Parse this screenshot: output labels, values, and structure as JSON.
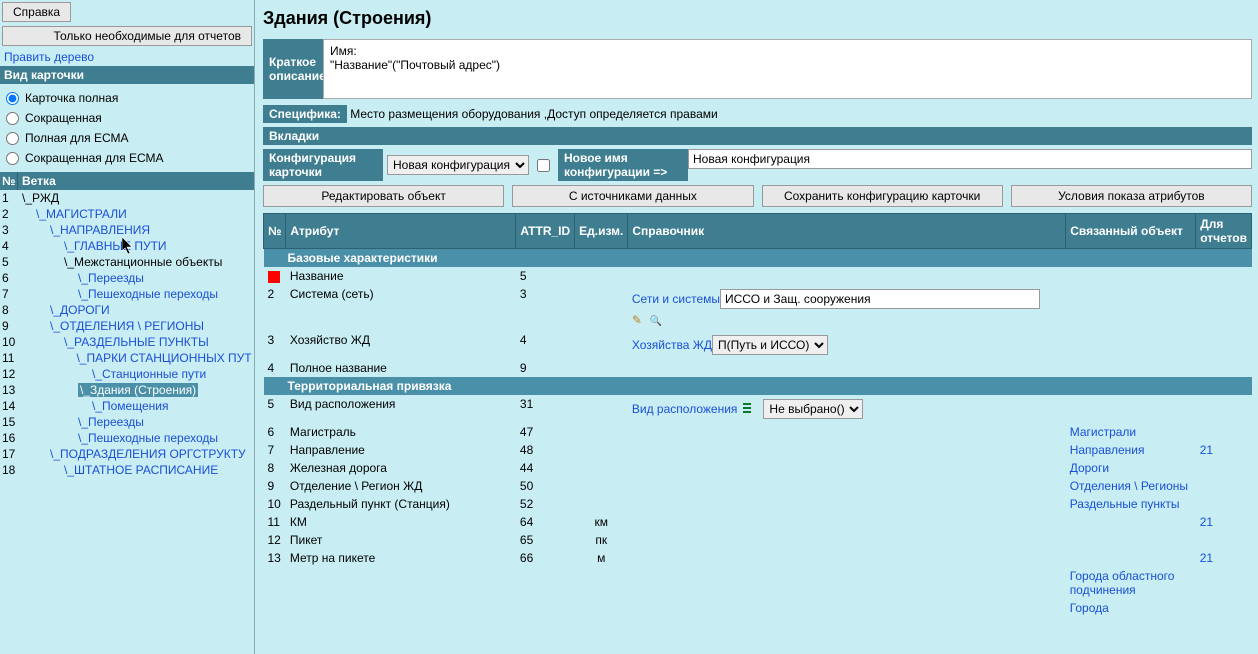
{
  "title": "Здания (Строения)",
  "left": {
    "btn_help": "Справка",
    "btn_only_needed": "Только необходимые для отчетов",
    "link_edit_tree": "Править дерево",
    "card_view_head": "Вид карточки",
    "radios": [
      "Карточка полная",
      "Сокращенная",
      "Полная для ЕСМА",
      "Сокращенная для ЕСМА"
    ],
    "tree_head_num": "№",
    "tree_head_branch": "Ветка",
    "tree": [
      {
        "n": "1",
        "indent": 0,
        "label": "\\_РЖД",
        "plain": true
      },
      {
        "n": "2",
        "indent": 1,
        "label": "\\_МАГИСТРАЛИ"
      },
      {
        "n": "3",
        "indent": 2,
        "label": "\\_НАПРАВЛЕНИЯ"
      },
      {
        "n": "4",
        "indent": 3,
        "label": "\\_ГЛАВНЫЕ ПУТИ"
      },
      {
        "n": "5",
        "indent": 3,
        "label": "\\_Межстанционные объекты",
        "plain": true
      },
      {
        "n": "6",
        "indent": 4,
        "label": "\\_Переезды"
      },
      {
        "n": "7",
        "indent": 4,
        "label": "\\_Пешеходные переходы"
      },
      {
        "n": "8",
        "indent": 2,
        "label": "\\_ДОРОГИ"
      },
      {
        "n": "9",
        "indent": 2,
        "label": "\\_ОТДЕЛЕНИЯ \\ РЕГИОНЫ"
      },
      {
        "n": "10",
        "indent": 3,
        "label": "\\_РАЗДЕЛЬНЫЕ ПУНКТЫ"
      },
      {
        "n": "11",
        "indent": 4,
        "label": "\\_ПАРКИ СТАНЦИОННЫХ ПУТ"
      },
      {
        "n": "12",
        "indent": 5,
        "label": "\\_Станционные пути"
      },
      {
        "n": "13",
        "indent": 4,
        "label": "\\_Здания (Строения)",
        "active": true
      },
      {
        "n": "14",
        "indent": 5,
        "label": "\\_Помещения"
      },
      {
        "n": "15",
        "indent": 4,
        "label": "\\_Переезды"
      },
      {
        "n": "16",
        "indent": 4,
        "label": "\\_Пешеходные переходы"
      },
      {
        "n": "17",
        "indent": 2,
        "label": "\\_ПОДРАЗДЕЛЕНИЯ ОРГСТРУКТУ"
      },
      {
        "n": "18",
        "indent": 3,
        "label": "\\_ШТАТНОЕ РАСПИСАНИЕ"
      }
    ]
  },
  "main": {
    "brief_label": "Краткое описание",
    "brief_name_label": "Имя:",
    "brief_name": "\"Название\"(\"Почтовый адрес\")",
    "spec_label": "Специфика:",
    "spec_text": "Место размещения оборудования ,Доступ определяется правами",
    "tabs_label": "Вкладки",
    "config_label": "Конфигурация карточки",
    "config_select": "Новая конфигурация",
    "newname_label": "Новое имя конфигурации =>",
    "newname_value": "Новая конфигурация",
    "actions": [
      "Редактировать объект",
      "С источниками данных",
      "Сохранить конфигурацию карточки",
      "Условия показа атрибутов"
    ],
    "head": {
      "num": "№",
      "attr": "Атрибут",
      "id": "ATTR_ID",
      "unit": "Ед.изм.",
      "ref": "Справочник",
      "obj": "Связанный объект",
      "rep": "Для отчетов"
    },
    "group1": "Базовые характеристики",
    "group2": "Территориальная привязка",
    "rows": [
      {
        "n": "",
        "attr": "Название",
        "id": "5",
        "red": true
      },
      {
        "n": "2",
        "attr": "Система (сеть)",
        "id": "3",
        "ref_label": "Сети и системы",
        "ref_input": "ИССО и Защ. сооружения",
        "edit": true
      },
      {
        "n": "3",
        "attr": "Хозяйство ЖД",
        "id": "4",
        "ref_label": "Хозяйства ЖД",
        "ref_select": "П(Путь и ИССО)"
      },
      {
        "n": "4",
        "attr": "Полное название",
        "id": "9"
      }
    ],
    "rows2": [
      {
        "n": "5",
        "attr": "Вид расположения",
        "id": "31",
        "ref_label": "Вид расположения",
        "ref_select": "Не выбрано()",
        "tree_icon": true
      },
      {
        "n": "6",
        "attr": "Магистраль",
        "id": "47",
        "obj": "Магистрали"
      },
      {
        "n": "7",
        "attr": "Направление",
        "id": "48",
        "obj": "Направления",
        "rep": "21"
      },
      {
        "n": "8",
        "attr": "Железная дорога",
        "id": "44",
        "obj": "Дороги"
      },
      {
        "n": "9",
        "attr": "Отделение \\ Регион ЖД",
        "id": "50",
        "obj": "Отделения \\ Регионы"
      },
      {
        "n": "10",
        "attr": "Раздельный пункт (Станция)",
        "id": "52",
        "obj": "Раздельные пункты"
      },
      {
        "n": "11",
        "attr": "КМ",
        "id": "64",
        "unit": "км",
        "rep": "21"
      },
      {
        "n": "12",
        "attr": "Пикет",
        "id": "65",
        "unit": "пк"
      },
      {
        "n": "13",
        "attr": "Метр на пикете",
        "id": "66",
        "unit": "м",
        "rep": "21"
      },
      {
        "n": "",
        "attr": "",
        "id": "",
        "obj": "Города областного подчинения"
      },
      {
        "n": "",
        "attr": "",
        "id": "",
        "obj": "Города"
      }
    ]
  }
}
